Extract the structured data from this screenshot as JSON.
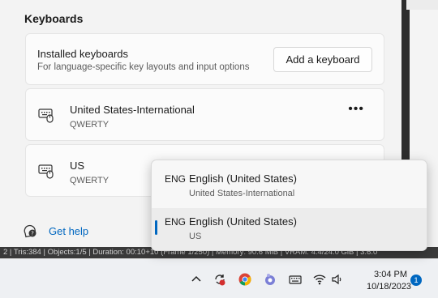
{
  "settings": {
    "section_title": "Keyboards",
    "installed": {
      "title": "Installed keyboards",
      "subtitle": "For language-specific key layouts and input options",
      "add_button": "Add a keyboard"
    },
    "keyboards": [
      {
        "name": "United States-International",
        "layout": "QWERTY",
        "more": "•••"
      },
      {
        "name": "US",
        "layout": "QWERTY"
      }
    ],
    "help_link": "Get help"
  },
  "statbar": {
    "text": "2 | Tris:384 | Objects:1/5 | Duration: 00:10+10 (Frame 1/250) | Memory: 90.6 MiB | VRAM: 4.4/24.0 GiB | 3.6.0"
  },
  "flyout": {
    "items": [
      {
        "code": "ENG",
        "language": "English (United States)",
        "keyboard": "United States-International",
        "selected": false
      },
      {
        "code": "ENG",
        "language": "English (United States)",
        "keyboard": "US",
        "selected": true
      }
    ]
  },
  "taskbar": {
    "time": "3:04 PM",
    "date": "10/18/2023",
    "notification_count": "1",
    "icons": [
      "chevron-up-icon",
      "sync-alert-icon",
      "chrome-icon",
      "app-icon",
      "keyboard-icon",
      "wifi-icon",
      "volume-icon"
    ]
  },
  "colors": {
    "accent": "#0067c0",
    "background": "#f3f3f3",
    "card": "#fbfbfb"
  }
}
